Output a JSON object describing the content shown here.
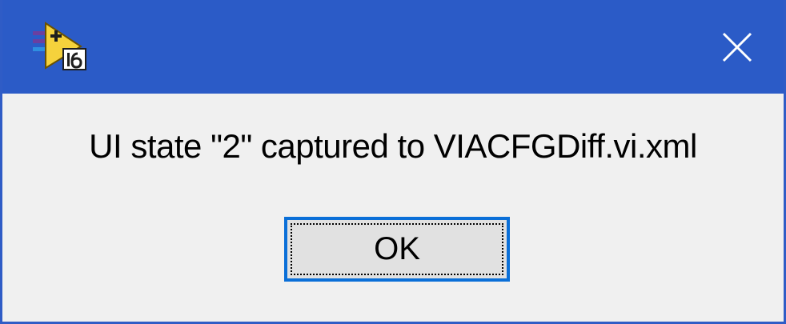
{
  "window": {
    "icon": "labview-vi-icon",
    "close_icon": "close-icon",
    "close_glyph": "✕"
  },
  "dialog": {
    "message": "UI state \"2\" captured to VIACFGDiff.vi.xml",
    "ok_label": "OK"
  },
  "colors": {
    "titlebar": "#2b5bc7",
    "background": "#f0f0f0",
    "button_focus_border": "#0a6fd8",
    "button_face": "#e1e1e1"
  }
}
